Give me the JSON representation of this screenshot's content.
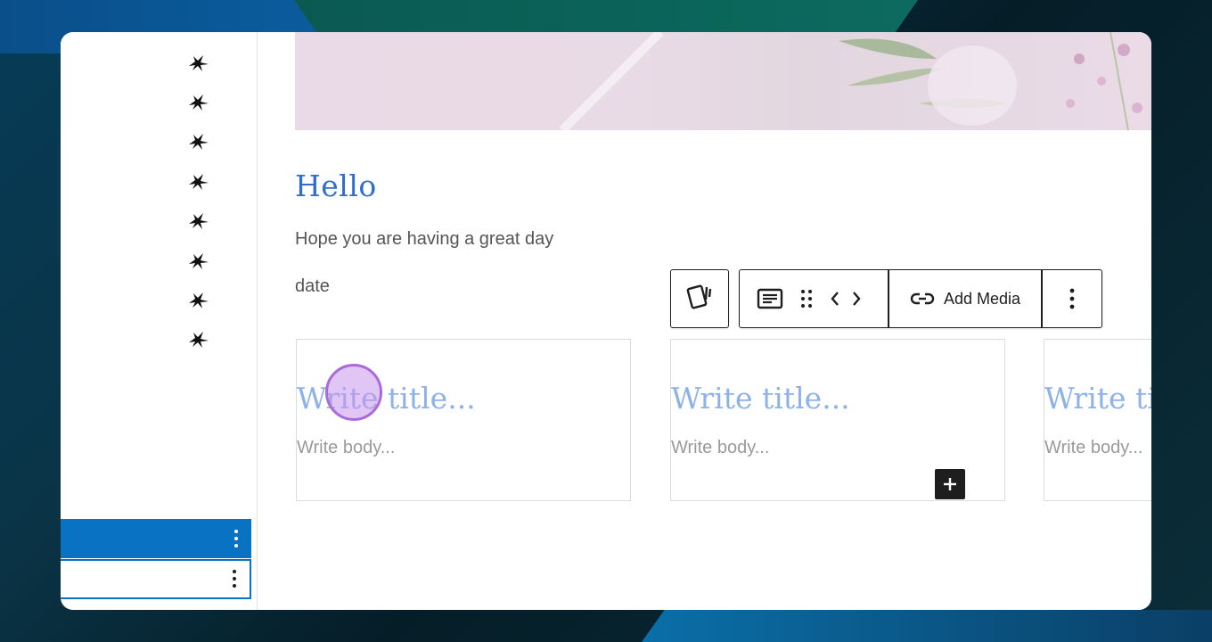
{
  "background": {
    "accent": "#0a72c2"
  },
  "sidebar": {
    "icons": [
      "bird-icon",
      "bird-icon",
      "bird-icon",
      "bird-icon",
      "bird-icon",
      "bird-icon",
      "bird-icon",
      "bird-icon"
    ],
    "selected_row_color": "#0a72c2"
  },
  "editor": {
    "heading": "Hello",
    "paragraph": "Hope you are having a great day",
    "date_text": "date",
    "toolbar": {
      "add_media_label": "Add Media"
    },
    "cards": [
      {
        "title": "Write title...",
        "body": "Write body..."
      },
      {
        "title": "Write title...",
        "body": "Write body..."
      },
      {
        "title": "Write title...",
        "body": "Write body..."
      }
    ],
    "colors": {
      "heading": "#2f6ed0",
      "placeholder_title": "#8db2ea",
      "placeholder_body": "#9a9a9a"
    }
  }
}
